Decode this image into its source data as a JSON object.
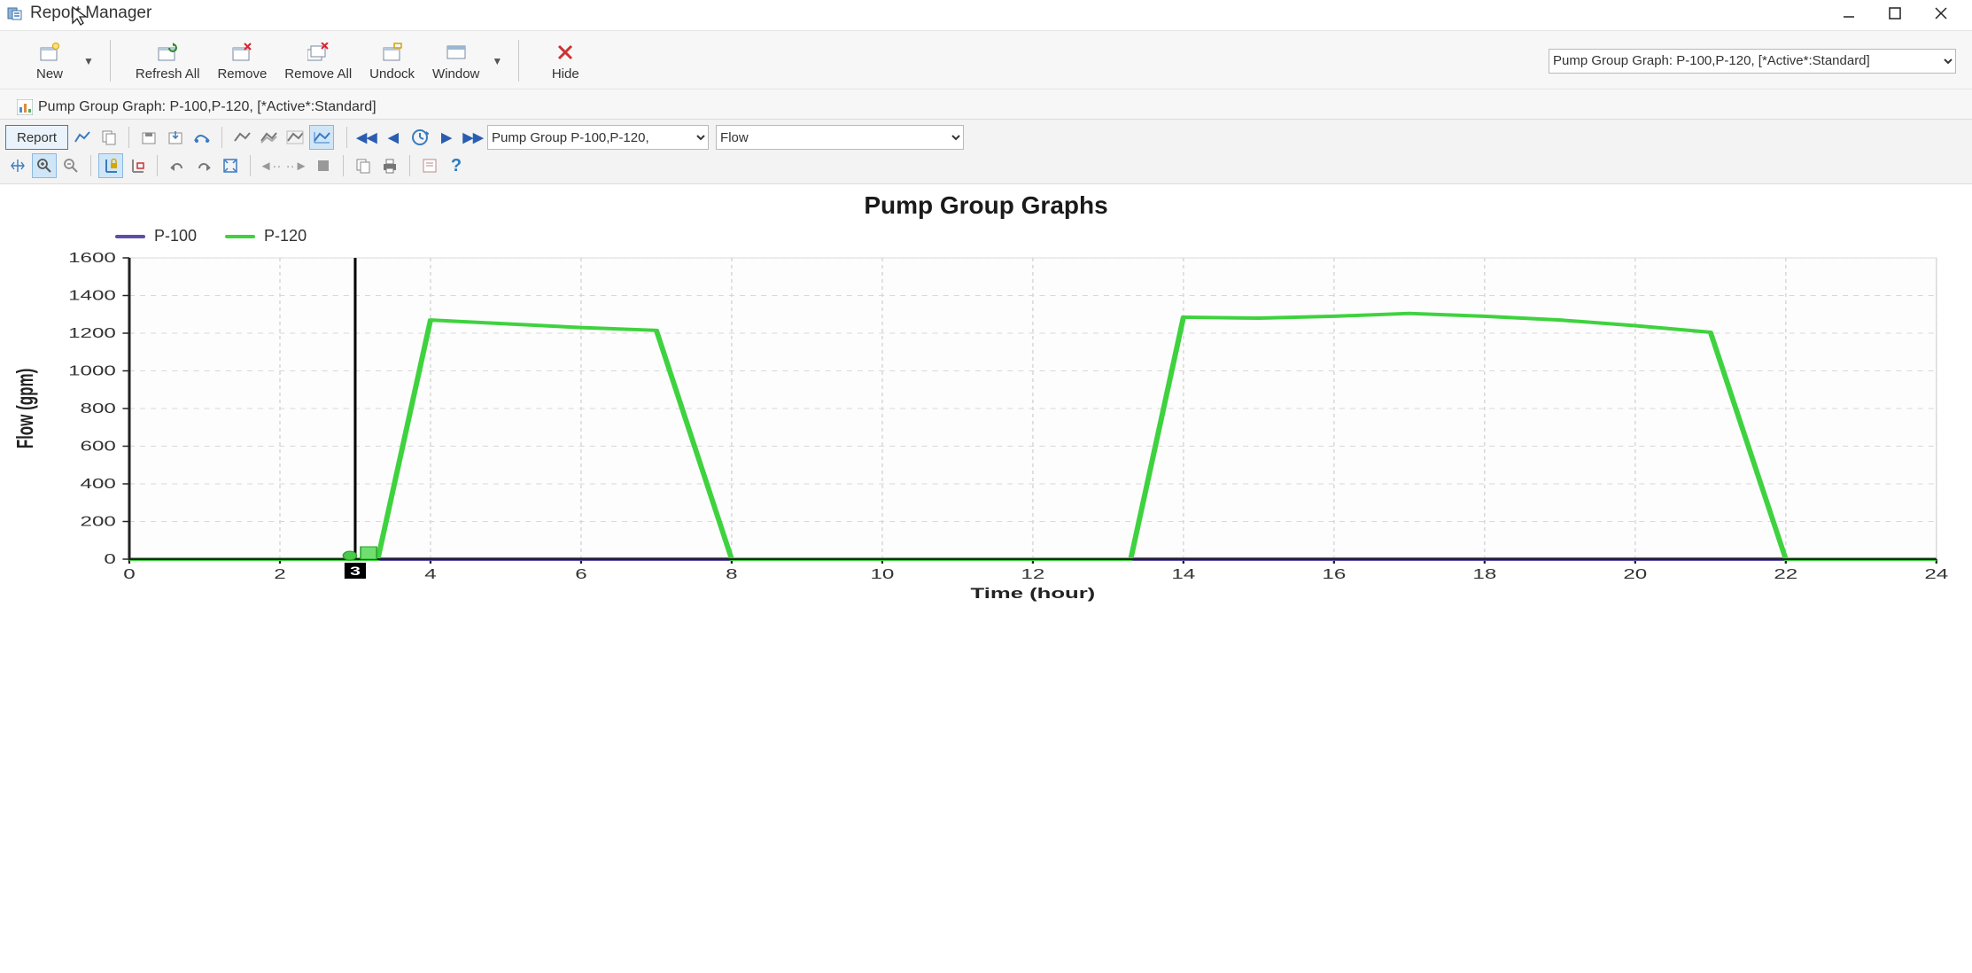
{
  "window": {
    "title": "Report Manager"
  },
  "ribbon": {
    "new_label": "New",
    "refresh_all_label": "Refresh All",
    "remove_label": "Remove",
    "remove_all_label": "Remove All",
    "undock_label": "Undock",
    "window_label": "Window",
    "hide_label": "Hide",
    "report_selector_value": "Pump Group Graph: P-100,P-120, [*Active*:Standard]"
  },
  "tab": {
    "label": "Pump Group Graph: P-100,P-120, [*Active*:Standard]"
  },
  "charttools": {
    "report_btn_label": "Report",
    "group_selector_value": "Pump Group P-100,P-120,",
    "metric_selector_value": "Flow"
  },
  "chart_data": {
    "type": "line",
    "title": "Pump Group Graphs",
    "xlabel": "Time (hour)",
    "ylabel": "Flow (gpm)",
    "xlim": [
      0,
      24
    ],
    "ylim": [
      0,
      1600
    ],
    "xticks": [
      0,
      2,
      4,
      6,
      8,
      10,
      12,
      14,
      16,
      18,
      20,
      22,
      24
    ],
    "yticks": [
      0,
      200,
      400,
      600,
      800,
      1000,
      1200,
      1400,
      1600
    ],
    "cursor_x": 3,
    "series": [
      {
        "name": "P-100",
        "color": "#5b4fa8",
        "x": [
          0,
          1,
          2,
          3,
          4,
          5,
          6,
          7,
          8,
          9,
          10,
          11,
          12,
          13,
          14,
          15,
          16,
          17,
          18,
          19,
          20,
          21,
          22,
          23,
          24
        ],
        "y": [
          0,
          0,
          0,
          0,
          0,
          0,
          0,
          0,
          0,
          0,
          0,
          0,
          0,
          0,
          0,
          0,
          0,
          0,
          0,
          0,
          0,
          0,
          0,
          0,
          0
        ]
      },
      {
        "name": "P-120",
        "color": "#3fd23f",
        "x": [
          0,
          1,
          2,
          3,
          3.3,
          4,
          5,
          6,
          7,
          8,
          9,
          10,
          11,
          12,
          13,
          13.3,
          14,
          15,
          16,
          17,
          18,
          19,
          20,
          21,
          22,
          23,
          24
        ],
        "y": [
          0,
          0,
          0,
          0,
          0,
          1270,
          1250,
          1230,
          1215,
          0,
          0,
          0,
          0,
          0,
          0,
          0,
          1285,
          1280,
          1290,
          1305,
          1290,
          1270,
          1240,
          1205,
          0,
          0,
          0
        ]
      }
    ],
    "legend": [
      "P-100",
      "P-120"
    ]
  }
}
